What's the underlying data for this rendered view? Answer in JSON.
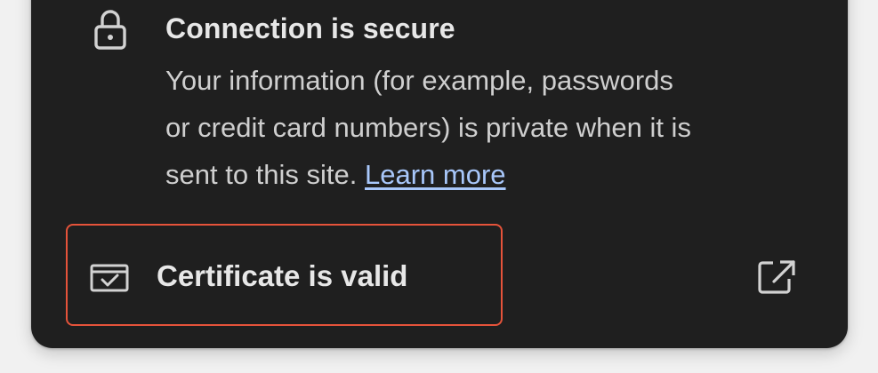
{
  "connection": {
    "title": "Connection is secure",
    "description_lines": [
      "Your information (for example, passwords",
      "or credit card numbers) is private when it is",
      "sent to this site."
    ],
    "learn_more": "Learn more",
    "icon": "lock-icon"
  },
  "certificate": {
    "label": "Certificate is valid",
    "icon": "certificate-icon",
    "action_icon": "open-in-new-icon"
  },
  "colors": {
    "panel_background": "#1f1f1f",
    "text_primary": "#e7e7e7",
    "text_secondary": "#cfcfcf",
    "link": "#a8c7fa",
    "highlight_border": "#e5533a"
  }
}
